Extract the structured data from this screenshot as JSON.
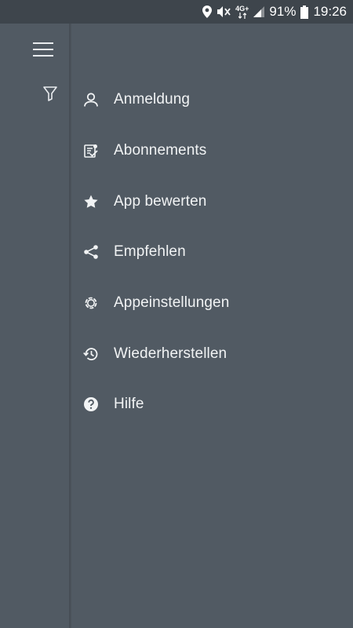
{
  "status_bar": {
    "network": "4G+",
    "battery": "91%",
    "time": "19:26",
    "icons": [
      "location-icon",
      "mute-icon",
      "signal-icon",
      "battery-icon"
    ]
  },
  "colors": {
    "background": "#515a63",
    "status_bar": "#3e454c",
    "text": "#f1f3f4"
  },
  "rail": {
    "icons": [
      "hamburger-menu-icon",
      "filter-icon"
    ]
  },
  "menu": {
    "items": [
      {
        "label": "Anmeldung",
        "icon": "person-icon"
      },
      {
        "label": "Abonnements",
        "icon": "subscription-icon"
      },
      {
        "label": "App bewerten",
        "icon": "star-icon"
      },
      {
        "label": "Empfehlen",
        "icon": "share-icon"
      },
      {
        "label": "Appeinstellungen",
        "icon": "settings-gear-icon"
      },
      {
        "label": "Wiederherstellen",
        "icon": "restore-history-icon"
      },
      {
        "label": "Hilfe",
        "icon": "help-icon"
      }
    ]
  }
}
